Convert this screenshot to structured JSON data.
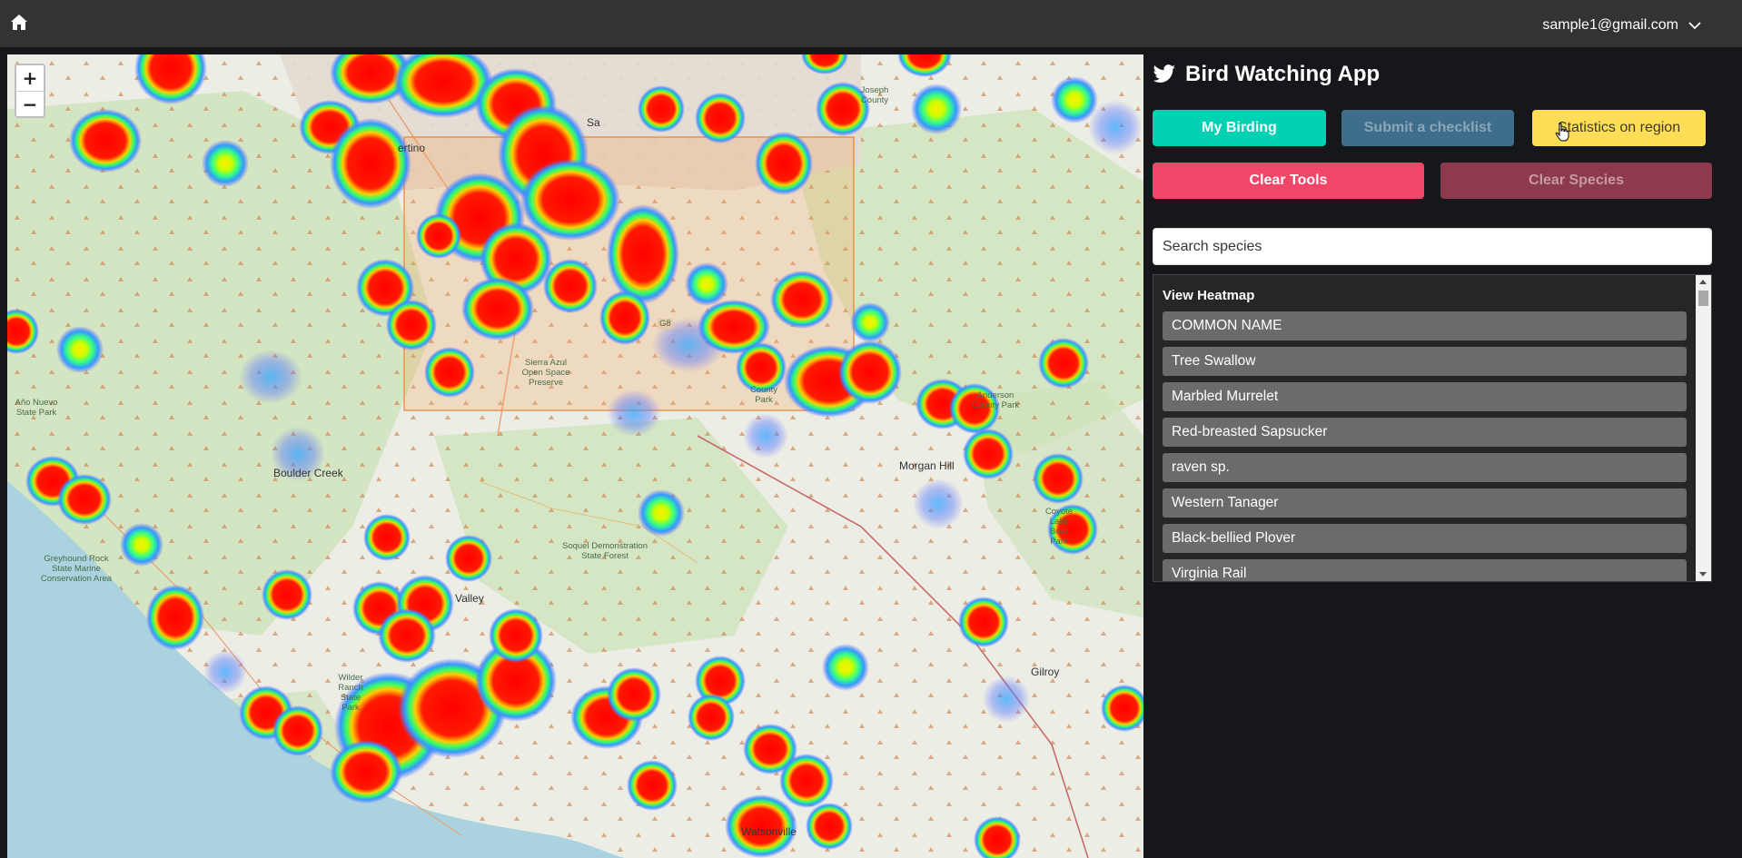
{
  "header": {
    "home_icon": "home-icon",
    "user_email": "sample1@gmail.com",
    "menu_icon": "chevron-down-icon"
  },
  "map": {
    "zoom_in": "+",
    "zoom_out": "−",
    "labels": [
      "Boulder Creek",
      "Morgan Hill",
      "Gilroy",
      "Watsonville",
      "Valley",
      "Sierra Azul Open Space Preserve",
      "Soquel Demonstration State Forest",
      "Greyhound Rock State Marine Conservation Area",
      "Año Nuevo State Park",
      "Wilder Ranch State Park",
      "County Park",
      "Coyote Lake Bear Park",
      "Anderson County Park",
      "ertino",
      "Sa",
      "Joseph County",
      "G8"
    ],
    "colors": {
      "water": "#aad3df",
      "park": "#cfe3bb",
      "land": "#eceee6",
      "region": "#f4a460"
    }
  },
  "panel": {
    "app_title": "Bird Watching App",
    "app_icon": "twitter-bird-icon",
    "buttons": {
      "my_birding": "My Birding",
      "submit_checklist": "Submit a checklist",
      "statistics": "Statistics on region",
      "clear_tools": "Clear Tools",
      "clear_species": "Clear Species"
    },
    "search": {
      "placeholder": "Search species",
      "value": ""
    },
    "heatmap": {
      "title": "View Heatmap",
      "items": [
        "COMMON NAME",
        "Tree Swallow",
        "Marbled Murrelet",
        "Red-breasted Sapsucker",
        "raven sp.",
        "Western Tanager",
        "Black-bellied Plover",
        "Virginia Rail"
      ]
    },
    "colors": {
      "primary": "#00d1b2",
      "info_disabled": "#3e6e8c",
      "warning": "#ffdd57",
      "danger": "#f14668",
      "danger_disabled": "#8c3a4c"
    }
  }
}
